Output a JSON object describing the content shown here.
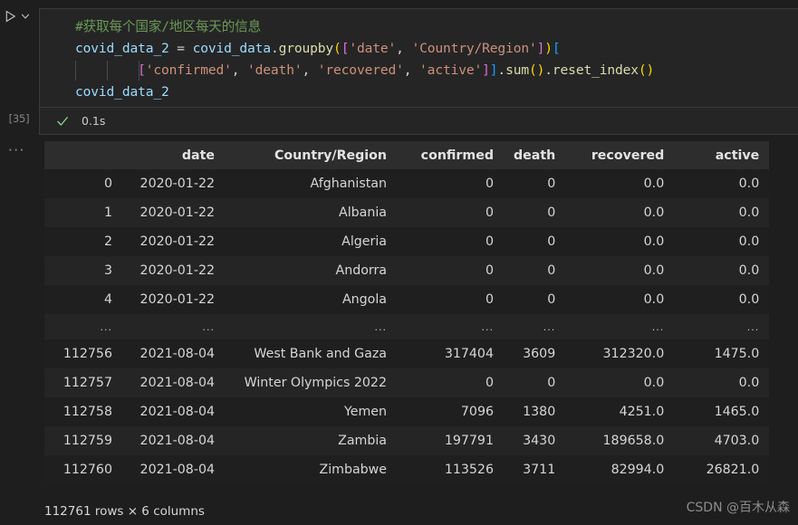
{
  "gutter": {
    "run_icon": "play-triangle-icon",
    "chevron_icon": "chevron-down-icon",
    "execution_count": "[35]",
    "more_actions": "···"
  },
  "cell": {
    "status_icon": "success-check-icon",
    "duration": "0.1s",
    "code_lines": [
      {
        "indent_guides": 0,
        "tokens": [
          {
            "t": "#获取每个国家/地区每天的信息",
            "c": "cmt"
          }
        ]
      },
      {
        "indent_guides": 0,
        "tokens": [
          {
            "t": "covid_data_2",
            "c": "var"
          },
          {
            "t": " ",
            "c": "op"
          },
          {
            "t": "=",
            "c": "op"
          },
          {
            "t": " ",
            "c": "op"
          },
          {
            "t": "covid_data",
            "c": "var"
          },
          {
            "t": ".",
            "c": "dot"
          },
          {
            "t": "groupby",
            "c": "fn"
          },
          {
            "t": "(",
            "c": "b-y"
          },
          {
            "t": "[",
            "c": "b-p"
          },
          {
            "t": "'date'",
            "c": "str"
          },
          {
            "t": ",",
            "c": "op"
          },
          {
            "t": " ",
            "c": "op"
          },
          {
            "t": "'Country/Region'",
            "c": "str"
          },
          {
            "t": "]",
            "c": "b-p"
          },
          {
            "t": ")",
            "c": "b-y"
          },
          {
            "t": "[",
            "c": "b-b"
          }
        ]
      },
      {
        "indent_guides": 3,
        "tokens": [
          {
            "t": "        ",
            "c": "op"
          },
          {
            "t": "[",
            "c": "b-p"
          },
          {
            "t": "'confirmed'",
            "c": "str"
          },
          {
            "t": ",",
            "c": "op"
          },
          {
            "t": " ",
            "c": "op"
          },
          {
            "t": "'death'",
            "c": "str"
          },
          {
            "t": ",",
            "c": "op"
          },
          {
            "t": " ",
            "c": "op"
          },
          {
            "t": "'recovered'",
            "c": "str"
          },
          {
            "t": ",",
            "c": "op"
          },
          {
            "t": " ",
            "c": "op"
          },
          {
            "t": "'active'",
            "c": "str"
          },
          {
            "t": "]",
            "c": "b-p"
          },
          {
            "t": "]",
            "c": "b-b"
          },
          {
            "t": ".",
            "c": "dot"
          },
          {
            "t": "sum",
            "c": "fn"
          },
          {
            "t": "(",
            "c": "b-y"
          },
          {
            "t": ")",
            "c": "b-y"
          },
          {
            "t": ".",
            "c": "dot"
          },
          {
            "t": "reset_index",
            "c": "fn"
          },
          {
            "t": "(",
            "c": "b-y"
          },
          {
            "t": ")",
            "c": "b-y"
          }
        ]
      },
      {
        "indent_guides": 0,
        "tokens": [
          {
            "t": "covid_data_2",
            "c": "var"
          }
        ]
      }
    ]
  },
  "output": {
    "columns": [
      "",
      "date",
      "Country/Region",
      "confirmed",
      "death",
      "recovered",
      "active"
    ],
    "rows": [
      [
        "0",
        "2020-01-22",
        "Afghanistan",
        "0",
        "0",
        "0.0",
        "0.0"
      ],
      [
        "1",
        "2020-01-22",
        "Albania",
        "0",
        "0",
        "0.0",
        "0.0"
      ],
      [
        "2",
        "2020-01-22",
        "Algeria",
        "0",
        "0",
        "0.0",
        "0.0"
      ],
      [
        "3",
        "2020-01-22",
        "Andorra",
        "0",
        "0",
        "0.0",
        "0.0"
      ],
      [
        "4",
        "2020-01-22",
        "Angola",
        "0",
        "0",
        "0.0",
        "0.0"
      ],
      [
        "...",
        "...",
        "...",
        "...",
        "...",
        "...",
        "..."
      ],
      [
        "112756",
        "2021-08-04",
        "West Bank and Gaza",
        "317404",
        "3609",
        "312320.0",
        "1475.0"
      ],
      [
        "112757",
        "2021-08-04",
        "Winter Olympics 2022",
        "0",
        "0",
        "0.0",
        "0.0"
      ],
      [
        "112758",
        "2021-08-04",
        "Yemen",
        "7096",
        "1380",
        "4251.0",
        "1465.0"
      ],
      [
        "112759",
        "2021-08-04",
        "Zambia",
        "197791",
        "3430",
        "189658.0",
        "4703.0"
      ],
      [
        "112760",
        "2021-08-04",
        "Zimbabwe",
        "113526",
        "3711",
        "82994.0",
        "26821.0"
      ]
    ],
    "shape_note": "112761 rows × 6 columns"
  },
  "watermark": "CSDN @百木从森",
  "colors": {
    "background": "#1e1e1e",
    "cell_background": "#252526",
    "header_background": "#2d2d2d",
    "row_stripe": "#252526",
    "comment": "#6a9955",
    "variable": "#9cdcfe",
    "string": "#ce9178",
    "function": "#dcdcaa",
    "bracket_yellow": "#ffd700",
    "bracket_pink": "#da70d6",
    "bracket_blue": "#179fff",
    "success": "#89d185"
  }
}
